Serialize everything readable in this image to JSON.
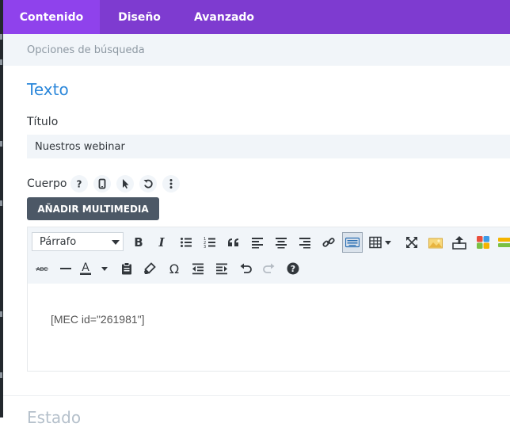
{
  "tabs": [
    {
      "label": "Contenido",
      "active": true
    },
    {
      "label": "Diseño",
      "active": false
    },
    {
      "label": "Avanzado",
      "active": false
    }
  ],
  "subheader": {
    "label": "Opciones de búsqueda"
  },
  "section": {
    "title": "Texto"
  },
  "title_field": {
    "label": "Título",
    "value": "Nuestros webinar"
  },
  "body_field": {
    "label": "Cuerpo",
    "option_icons": [
      "help-icon",
      "mobile-icon",
      "pointer-icon",
      "reset-icon",
      "more-vert-icon"
    ]
  },
  "media_button": {
    "label": "AÑADIR MULTIMEDIA"
  },
  "editor": {
    "format_select": "Párrafo",
    "toolbar_row1": [
      "bold-icon",
      "italic-icon",
      "bullet-list-icon",
      "numbered-list-icon",
      "blockquote-icon",
      "align-left-icon",
      "align-center-icon",
      "align-right-icon",
      "link-icon",
      "keyboard-icon",
      "table-icon",
      "fullscreen-icon",
      "image-icon",
      "upload-icon",
      "grid-colors-icon",
      "more-icon"
    ],
    "toolbar_row2": [
      "strikethrough-icon",
      "horizontal-rule-icon",
      "text-color-icon",
      "paste-text-icon",
      "clear-format-icon",
      "omega-icon",
      "outdent-icon",
      "indent-icon",
      "undo-icon",
      "redo-icon",
      "help-circle-icon"
    ],
    "content": "[MEC id=\"261981\"]"
  },
  "next_section": {
    "title": "Estado"
  },
  "colors": {
    "tab_bar": "#7e3bd0",
    "tab_active": "#8f42ec",
    "section_title": "#2b87da",
    "button": "#4c5866"
  }
}
